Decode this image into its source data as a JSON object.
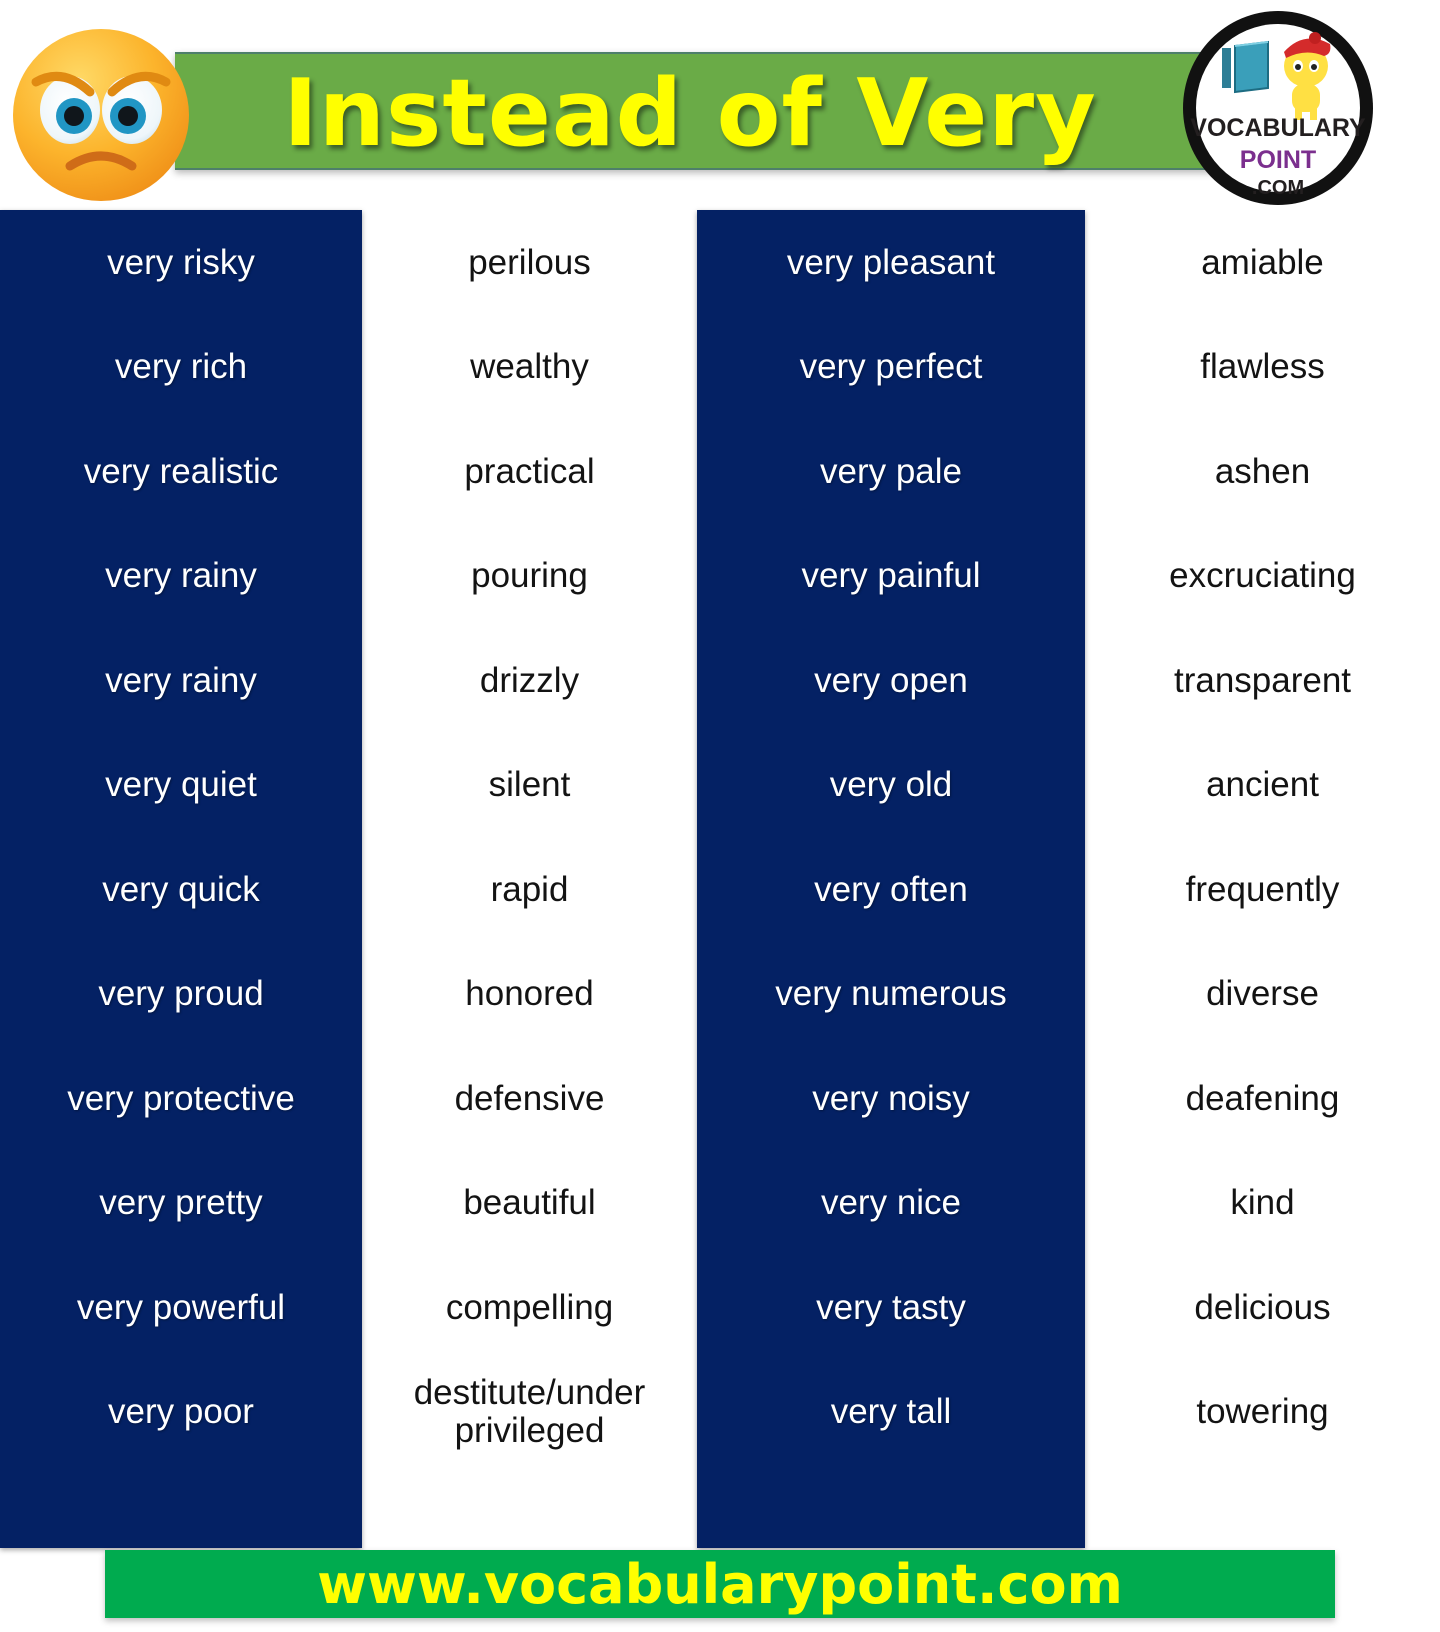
{
  "header": {
    "title": "Instead of Very",
    "title_color": "#ffff00",
    "bar_color": "#6aab47",
    "emoji_icon": "angry-face-emoji"
  },
  "logo": {
    "line1": "VOCABULARY",
    "line2": "POINT",
    "line3": ".COM",
    "line1_color": "#231f20",
    "line2_color": "#7b2f8e",
    "line3_color": "#231f20",
    "mascot_icon": "chick-mascot-with-red-cap",
    "book_icon": "blue-book-icon"
  },
  "table": {
    "band_color": "#042164",
    "term_color": "#ffffff",
    "synonym_color": "#131313",
    "rows": [
      {
        "term1": "very risky",
        "syn1": "perilous",
        "term2": "very pleasant",
        "syn2": "amiable"
      },
      {
        "term1": "very rich",
        "syn1": "wealthy",
        "term2": "very perfect",
        "syn2": "flawless"
      },
      {
        "term1": "very realistic",
        "syn1": "practical",
        "term2": "very pale",
        "syn2": "ashen"
      },
      {
        "term1": "very rainy",
        "syn1": "pouring",
        "term2": "very painful",
        "syn2": "excruciating"
      },
      {
        "term1": "very rainy",
        "syn1": "drizzly",
        "term2": "very open",
        "syn2": "transparent"
      },
      {
        "term1": "very quiet",
        "syn1": "silent",
        "term2": "very old",
        "syn2": "ancient"
      },
      {
        "term1": "very quick",
        "syn1": "rapid",
        "term2": "very often",
        "syn2": "frequently"
      },
      {
        "term1": "very proud",
        "syn1": "honored",
        "term2": "very numerous",
        "syn2": "diverse"
      },
      {
        "term1": "very protective",
        "syn1": "defensive",
        "term2": "very noisy",
        "syn2": "deafening"
      },
      {
        "term1": "very pretty",
        "syn1": "beautiful",
        "term2": "very nice",
        "syn2": "kind"
      },
      {
        "term1": "very powerful",
        "syn1": "compelling",
        "term2": "very tasty",
        "syn2": "delicious"
      },
      {
        "term1": "very poor",
        "syn1": "destitute/under privileged",
        "term2": "very tall",
        "syn2": "towering"
      }
    ]
  },
  "footer": {
    "url": "www.vocabularypoint.com",
    "bar_color": "#00ab4f",
    "text_color": "#ffff00"
  }
}
